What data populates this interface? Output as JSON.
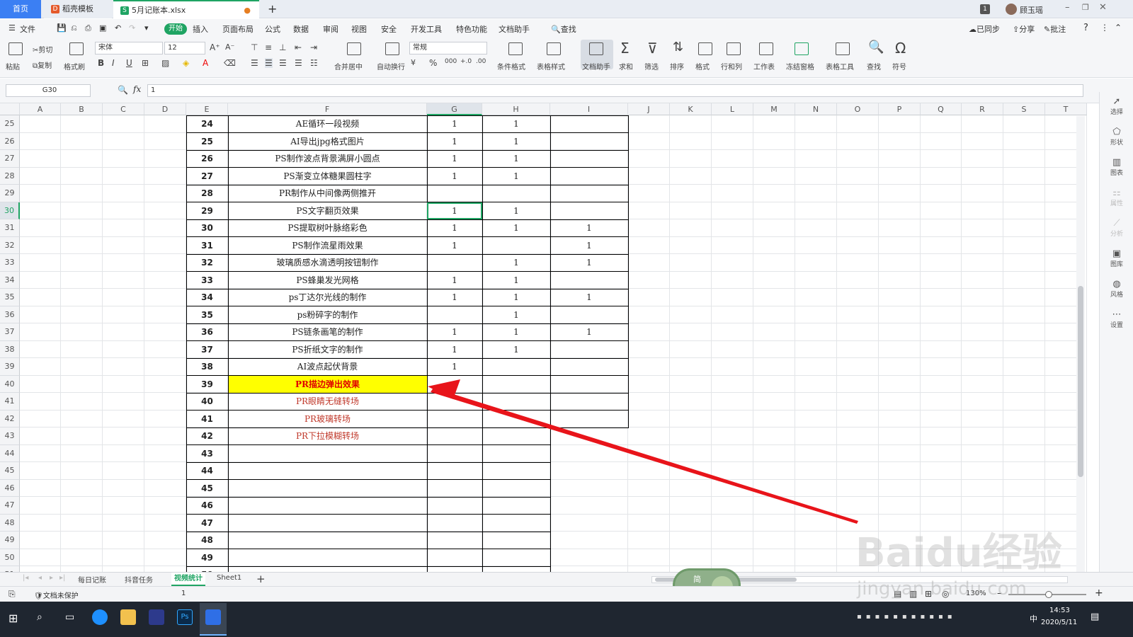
{
  "tabs": {
    "home": "首页",
    "template": "稻壳模板",
    "file": "5月记账本.xlsx",
    "new": "+"
  },
  "titlebar": {
    "badge": "1",
    "user": "顾玉瑶"
  },
  "menu": {
    "file": "文件",
    "start": "开始",
    "items": [
      "插入",
      "页面布局",
      "公式",
      "数据",
      "审阅",
      "视图",
      "安全",
      "开发工具",
      "特色功能",
      "文档助手"
    ],
    "find": "查找",
    "sync": "已同步",
    "share": "分享",
    "comment": "批注"
  },
  "ribbon": {
    "paste": "粘贴",
    "cut": "剪切",
    "copy": "复制",
    "format_painter": "格式刷",
    "font_name": "宋体",
    "font_size": "12",
    "number_format": "常规",
    "merge": "合并居中",
    "wrap": "自动换行",
    "cond_format": "条件格式",
    "table_style": "表格样式",
    "doc_assistant": "文档助手",
    "sum": "求和",
    "filter": "筛选",
    "sort": "排序",
    "format": "格式",
    "rowcol": "行和列",
    "worksheet": "工作表",
    "freeze": "冻结窗格",
    "table_tools": "表格工具",
    "find": "查找",
    "symbol": "符号"
  },
  "formula_bar": {
    "name_box": "G30",
    "fx": "fx",
    "value": "1"
  },
  "columns": [
    "A",
    "B",
    "C",
    "D",
    "E",
    "F",
    "G",
    "H",
    "I",
    "J",
    "K",
    "L",
    "M",
    "N",
    "O",
    "P",
    "Q",
    "R",
    "S",
    "T"
  ],
  "rows": [
    {
      "r": "25",
      "e": "24",
      "f": "AE循环一段视频",
      "g": "1",
      "h": "1",
      "i": ""
    },
    {
      "r": "26",
      "e": "25",
      "f": "AI导出jpg格式图片",
      "g": "1",
      "h": "1",
      "i": ""
    },
    {
      "r": "27",
      "e": "26",
      "f": "PS制作波点背景满屏小圆点",
      "g": "1",
      "h": "1",
      "i": ""
    },
    {
      "r": "28",
      "e": "27",
      "f": "PS渐变立体糖果圆柱字",
      "g": "1",
      "h": "1",
      "i": ""
    },
    {
      "r": "29",
      "e": "28",
      "f": "PR制作从中间像两侧推开",
      "g": "",
      "h": "",
      "i": ""
    },
    {
      "r": "30",
      "e": "29",
      "f": "PS文字翻页效果",
      "g": "1",
      "h": "1",
      "i": ""
    },
    {
      "r": "31",
      "e": "30",
      "f": "PS提取树叶脉络彩色",
      "g": "1",
      "h": "1",
      "i": "1"
    },
    {
      "r": "32",
      "e": "31",
      "f": "PS制作流星雨效果",
      "g": "1",
      "h": "",
      "i": "1"
    },
    {
      "r": "33",
      "e": "32",
      "f": "玻璃质感水滴透明按钮制作",
      "g": "",
      "h": "1",
      "i": "1"
    },
    {
      "r": "34",
      "e": "33",
      "f": "PS蜂巢发光网格",
      "g": "1",
      "h": "1",
      "i": ""
    },
    {
      "r": "35",
      "e": "34",
      "f": "ps丁达尔光线的制作",
      "g": "1",
      "h": "1",
      "i": "1"
    },
    {
      "r": "36",
      "e": "35",
      "f": "ps粉碎字的制作",
      "g": "",
      "h": "1",
      "i": ""
    },
    {
      "r": "37",
      "e": "36",
      "f": "PS链条画笔的制作",
      "g": "1",
      "h": "1",
      "i": "1"
    },
    {
      "r": "38",
      "e": "37",
      "f": "PS折纸文字的制作",
      "g": "1",
      "h": "1",
      "i": ""
    },
    {
      "r": "39",
      "e": "38",
      "f": "AI波点起伏背景",
      "g": "1",
      "h": "",
      "i": ""
    },
    {
      "r": "40",
      "e": "39",
      "f": "PR描边弹出效果",
      "g": "",
      "h": "",
      "i": ""
    },
    {
      "r": "41",
      "e": "40",
      "f": "PR眼睛无缝转场",
      "g": "",
      "h": "",
      "i": ""
    },
    {
      "r": "42",
      "e": "41",
      "f": "PR玻璃转场",
      "g": "",
      "h": "",
      "i": ""
    },
    {
      "r": "43",
      "e": "42",
      "f": "PR下拉模糊转场",
      "g": "",
      "h": "",
      "i": ""
    },
    {
      "r": "44",
      "e": "43",
      "f": "",
      "g": "",
      "h": "",
      "i": ""
    },
    {
      "r": "45",
      "e": "44",
      "f": "",
      "g": "",
      "h": "",
      "i": ""
    },
    {
      "r": "46",
      "e": "45",
      "f": "",
      "g": "",
      "h": "",
      "i": ""
    },
    {
      "r": "47",
      "e": "46",
      "f": "",
      "g": "",
      "h": "",
      "i": ""
    },
    {
      "r": "48",
      "e": "47",
      "f": "",
      "g": "",
      "h": "",
      "i": ""
    },
    {
      "r": "49",
      "e": "48",
      "f": "",
      "g": "",
      "h": "",
      "i": ""
    },
    {
      "r": "50",
      "e": "49",
      "f": "",
      "g": "",
      "h": "",
      "i": ""
    },
    {
      "r": "51",
      "e": "50",
      "f": "",
      "g": "",
      "h": "",
      "i": ""
    }
  ],
  "highlight": {
    "row": "40",
    "fill": "#ffff00",
    "text_color": "#e00000"
  },
  "red_text_rows": [
    "41",
    "42",
    "43"
  ],
  "red_text_color": "#c0392b",
  "selected_cell": "G30",
  "accent": "#1fa463",
  "sidebar": [
    "选择",
    "形状",
    "图表",
    "属性",
    "分析",
    "图库",
    "风格",
    "设置"
  ],
  "sheets": [
    "每日记账",
    "抖音任务",
    "视频统计",
    "Sheet1"
  ],
  "active_sheet": "视频统计",
  "status": {
    "protect": "文档未保护",
    "value": "1",
    "zoom": "130%"
  },
  "clock": {
    "time": "14:53",
    "date": "2020/5/11",
    "ime": "中"
  },
  "watermark": {
    "brand": "Baidu经验",
    "url": "jingyan.baidu.com"
  },
  "float_widget": {
    "top": "简",
    "bottom": "中"
  }
}
